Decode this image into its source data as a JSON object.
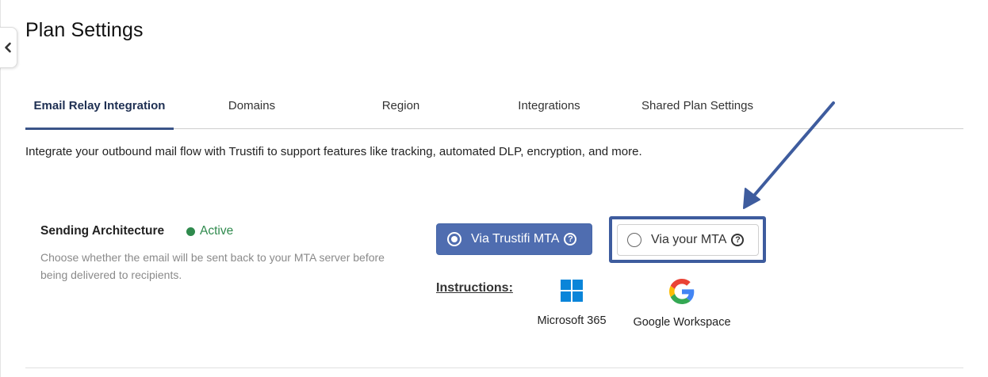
{
  "page": {
    "title": "Plan Settings"
  },
  "tabs": [
    {
      "label": "Email Relay Integration",
      "active": true
    },
    {
      "label": "Domains",
      "active": false
    },
    {
      "label": "Region",
      "active": false
    },
    {
      "label": "Integrations",
      "active": false
    },
    {
      "label": "Shared Plan Settings",
      "active": false
    }
  ],
  "intro": "Integrate your outbound mail flow with Trustifi to support features like tracking, automated DLP, encryption, and more.",
  "sending_architecture": {
    "title": "Sending Architecture",
    "status": "Active",
    "description": "Choose whether the email will be sent back to your MTA server before being delivered to recipients.",
    "options": [
      {
        "label": "Via Trustifi MTA",
        "selected": true
      },
      {
        "label": "Via your MTA",
        "selected": false
      }
    ],
    "instructions_label": "Instructions:",
    "integrations": [
      {
        "label": "Microsoft 365",
        "icon": "windows-logo-icon"
      },
      {
        "label": "Google Workspace",
        "icon": "google-logo-icon"
      }
    ]
  },
  "icons": {
    "collapse": "chevron-left-icon",
    "help": "question-circle-icon",
    "help_glyph": "?"
  },
  "colors": {
    "accent": "#3a5488",
    "primary_button": "#4f6db0",
    "status_active": "#2f8a4d",
    "annotation": "#3e5c9e"
  }
}
